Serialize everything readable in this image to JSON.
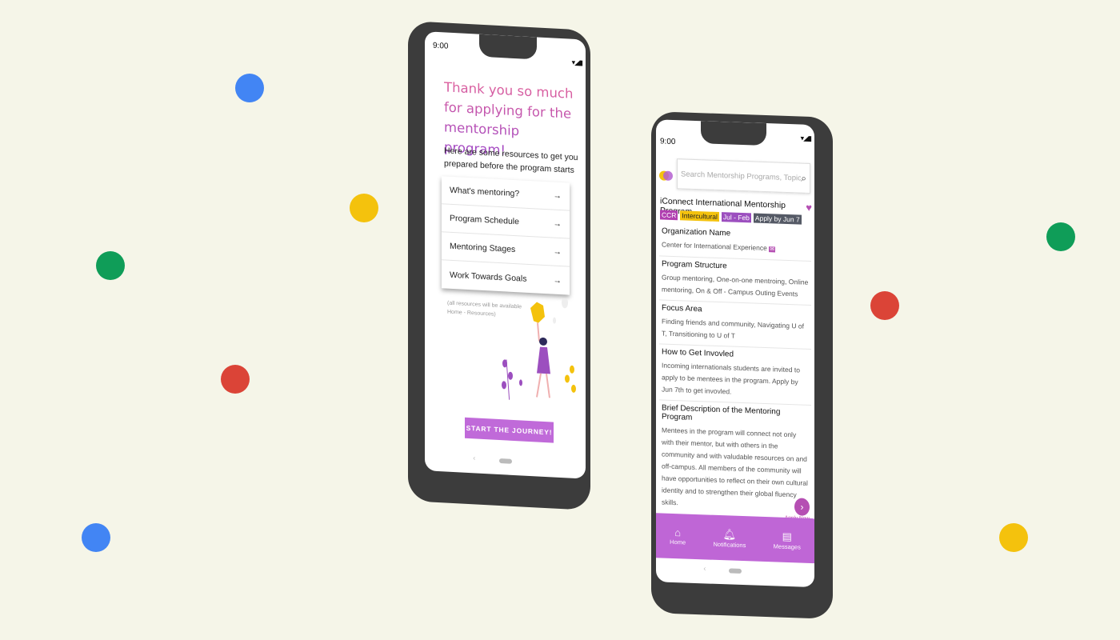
{
  "colors": {
    "background": "#f5f5e8",
    "blue": "#4285f4",
    "yellow": "#f4c20d",
    "green": "#0f9d58",
    "red": "#db4437",
    "accent": "#bf66d6"
  },
  "phone_left": {
    "status_time": "9:00",
    "title": "Thank you so much for applying for the mentorship program!",
    "intro": "Here are some resources to get you prepared before the program starts",
    "resources": [
      {
        "label": "What's mentoring?",
        "icon": "arrow-right-icon"
      },
      {
        "label": "Program Schedule",
        "icon": "arrow-right-icon"
      },
      {
        "label": "Mentoring Stages",
        "icon": "arrow-right-icon"
      },
      {
        "label": "Work Towards Goals",
        "icon": "arrow-right-icon"
      }
    ],
    "note": "(all resources will be available Home - Resources)",
    "button": "START THE JOURNEY!"
  },
  "phone_right": {
    "status_time": "9:00",
    "search_placeholder": "Search Mentorship Programs, Topics",
    "program_title": "iConnect International Mentorship Program",
    "tags": [
      {
        "label": "CCR",
        "color": "#b03fb0"
      },
      {
        "label": "Intercultural",
        "color": "#f4c20d"
      },
      {
        "label": "Jul - Feb",
        "color": "#9c4fbf"
      },
      {
        "label": "Apply by Jun 7",
        "color": "#555a66"
      }
    ],
    "sections": [
      {
        "heading": "Organization Name",
        "body": "Center for International Experience"
      },
      {
        "heading": "Program Structure",
        "body": "Group mentoring, One-on-one mentroing, Online mentoring, On & Off - Campus Outing Events"
      },
      {
        "heading": "Focus Area",
        "body": "Finding friends and community, Navigating U of T, Transitioning to U of T"
      },
      {
        "heading": "How to Get Invovled",
        "body": "Incoming internationals students are invited to apply to be mentees in the program. Apply by Jun 7th to get invovled."
      },
      {
        "heading": "Brief Description of the Mentoring Program",
        "body": "Mentees in the program will connect not only with their mentor, but with others in the community and with valudable resources on and off-campus. All members of the community will have opportunities to reflect on their own cultural identity and to strengthen their global fluency skills."
      }
    ],
    "apply_label": "Apply Now",
    "nav": [
      {
        "label": "Home",
        "icon": "home-icon"
      },
      {
        "label": "Notifications",
        "icon": "bell-icon"
      },
      {
        "label": "Messages",
        "icon": "message-icon"
      }
    ]
  }
}
